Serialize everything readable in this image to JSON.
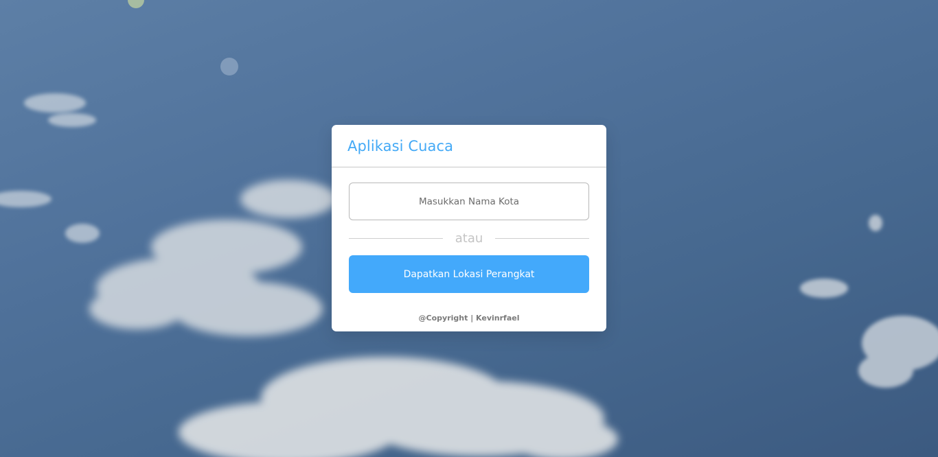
{
  "app": {
    "title": "Aplikasi Cuaca"
  },
  "search": {
    "placeholder": "Masukkan Nama Kota",
    "value": ""
  },
  "divider": {
    "label": "atau"
  },
  "location_button": {
    "label": "Dapatkan Lokasi Perangkat"
  },
  "footer": {
    "copyright": "@Copyright | Kevinrfael"
  },
  "colors": {
    "accent": "#43a9fb",
    "title": "#43a9f6",
    "background_sky": "#50729b"
  }
}
